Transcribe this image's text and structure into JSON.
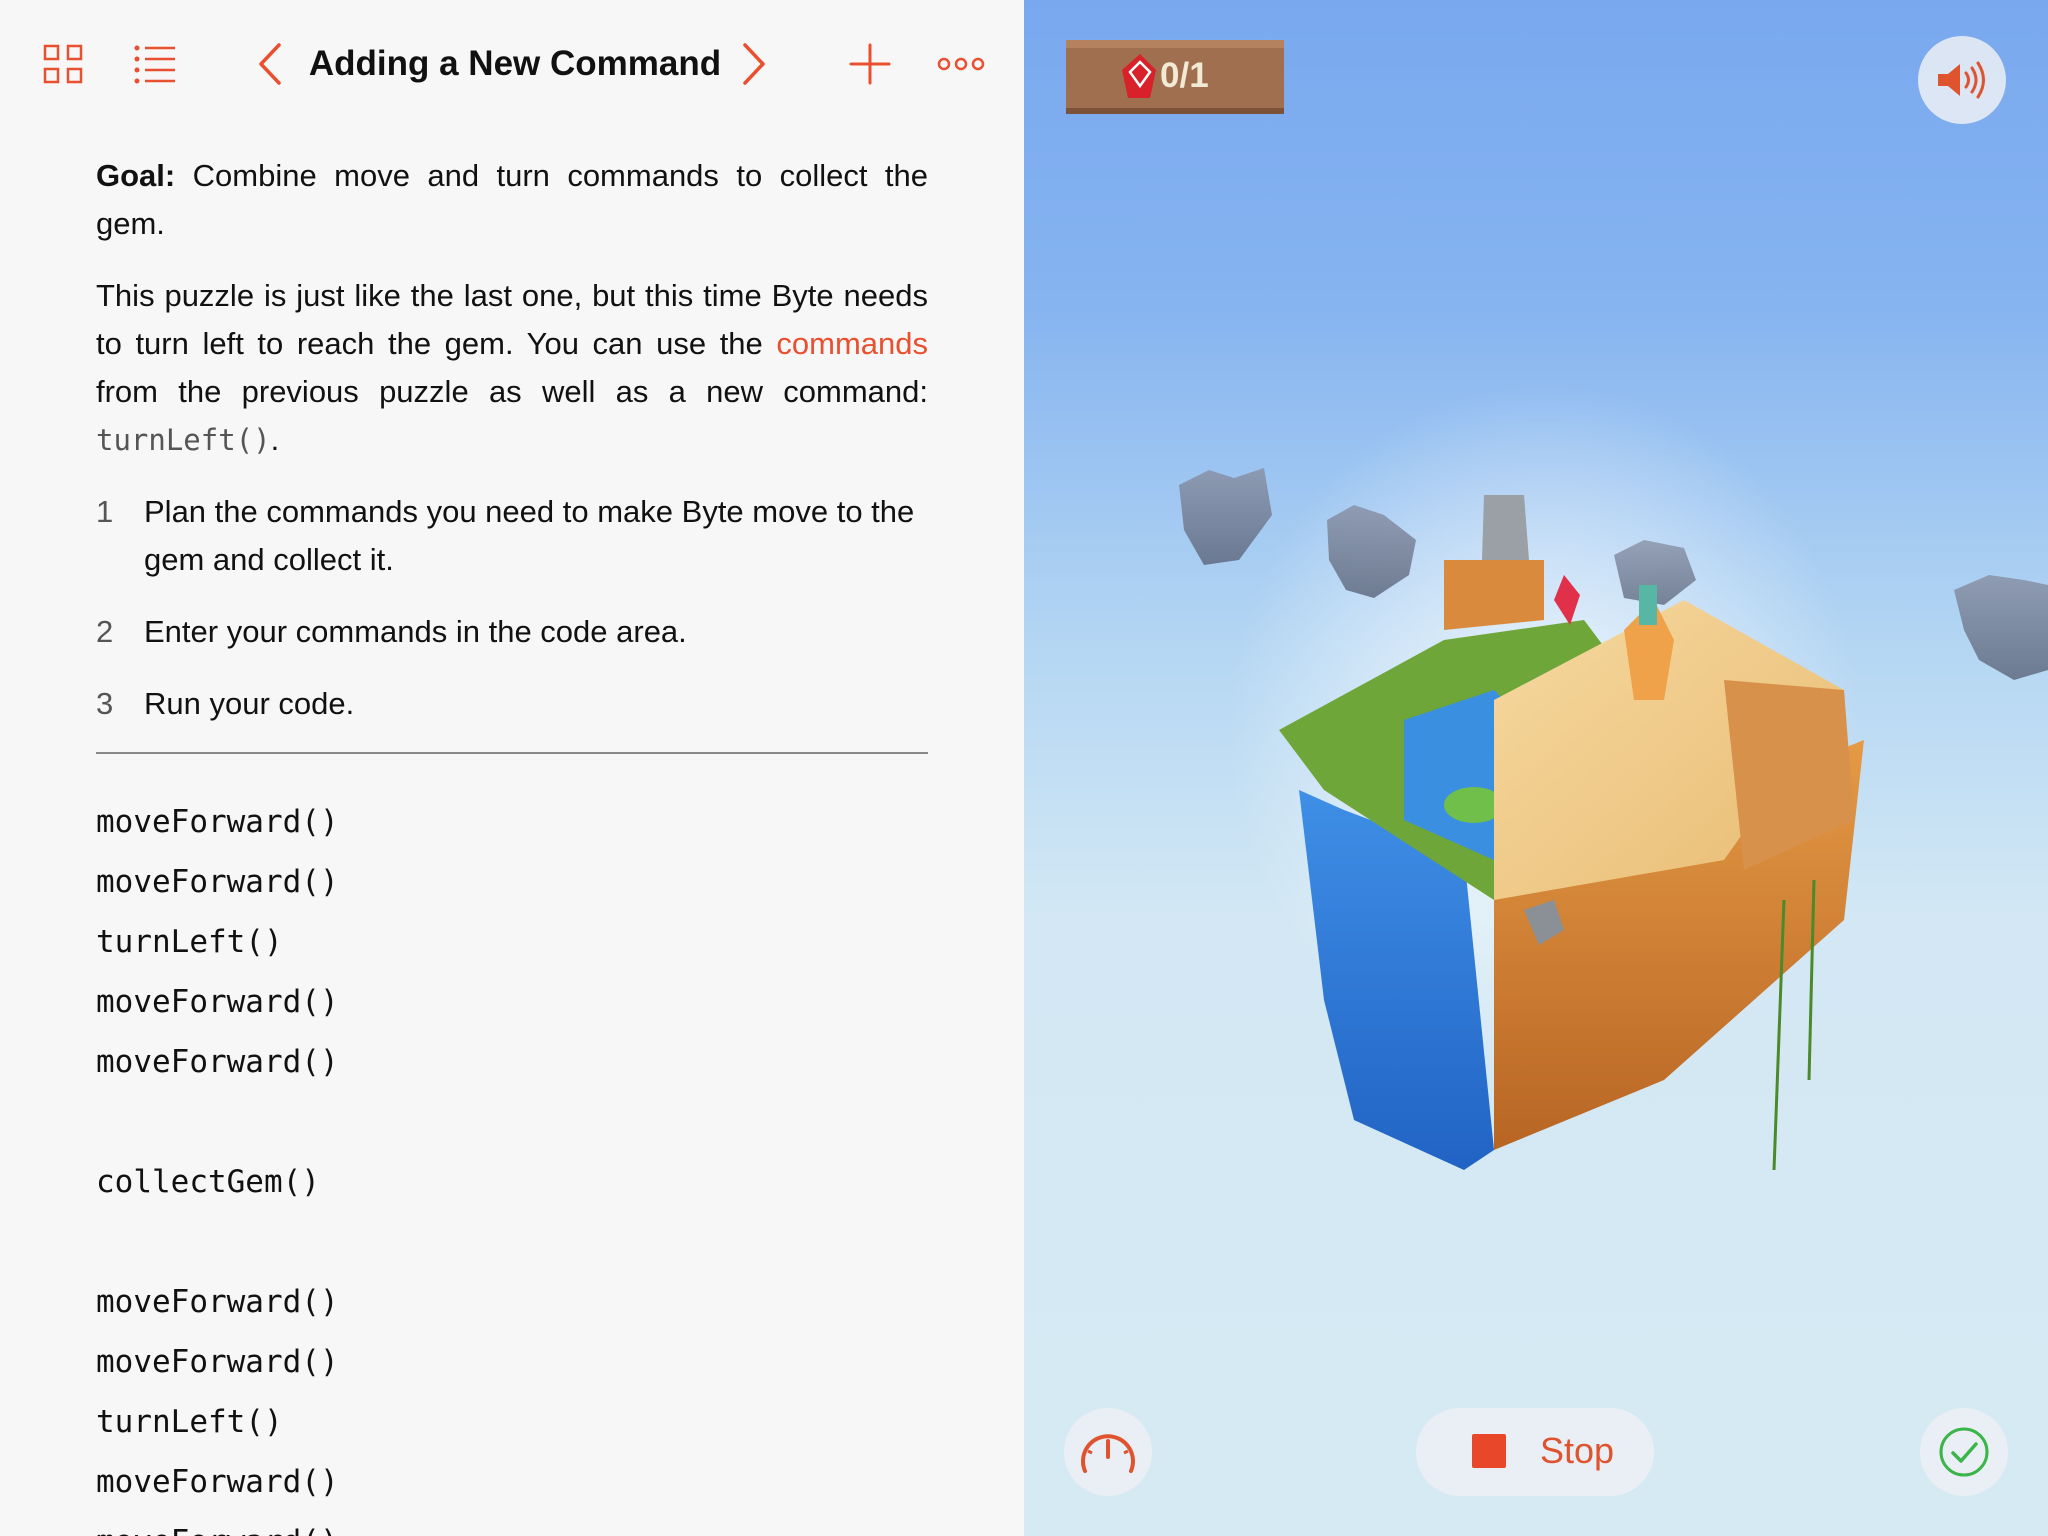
{
  "toolbar": {
    "title": "Adding a New Command"
  },
  "instructions": {
    "goal_label": "Goal:",
    "goal_text": " Combine move and turn commands to collect the gem.",
    "para_before_link": "This puzzle is just like the last one, but this time Byte needs to turn left to reach the gem. You can use the ",
    "link_text": "commands",
    "para_after_link": " from the previous puzzle as well as a new command: ",
    "code_inline": "turnLeft()",
    "para_end": ".",
    "steps": [
      {
        "num": "1",
        "text": "Plan the commands you need to make Byte move to the gem and collect it."
      },
      {
        "num": "2",
        "text": "Enter your commands in the code area."
      },
      {
        "num": "3",
        "text": "Run your code."
      }
    ]
  },
  "code_lines": [
    "moveForward()",
    "moveForward()",
    "turnLeft()",
    "moveForward()",
    "moveForward()",
    "",
    "collectGem()",
    "",
    "moveForward()",
    "moveForward()",
    "turnLeft()",
    "moveForward()",
    "moveForward()"
  ],
  "game": {
    "gem_counter": "0/1",
    "stop_label": "Stop"
  },
  "colors": {
    "accent": "#e8502f",
    "success": "#3bb54a",
    "sky_top": "#79a8ef"
  }
}
